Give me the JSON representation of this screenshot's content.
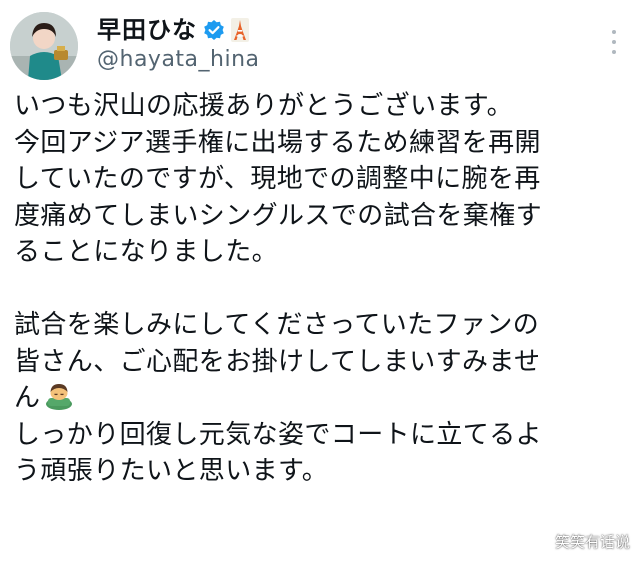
{
  "user": {
    "display_name": "早田ひな",
    "handle": "@hayata_hina",
    "verified_color": "#1d9bf0"
  },
  "tweet": {
    "lines": [
      "いつも沢山の応援ありがとうございます。",
      "今回アジア選手権に出場するため練習を再開",
      "していたのですが、現地での調整中に腕を再",
      "度痛めてしまいシングルスでの試合を棄権す",
      "ることになりました。",
      "",
      "試合を楽しみにしてくださっていたファンの",
      "皆さん、ご心配をお掛けしてしまいすみませ",
      "ん",
      "しっかり回復し元気な姿でコートに立てるよ",
      "う頑張りたいと思います。"
    ],
    "emoji_icon": "person-bowing-emoji"
  },
  "watermark": {
    "text": "笑笑有话说"
  },
  "icons": {
    "verified": "verified-badge-icon",
    "tower": "tokyo-tower-icon",
    "more": "more-options-icon"
  }
}
